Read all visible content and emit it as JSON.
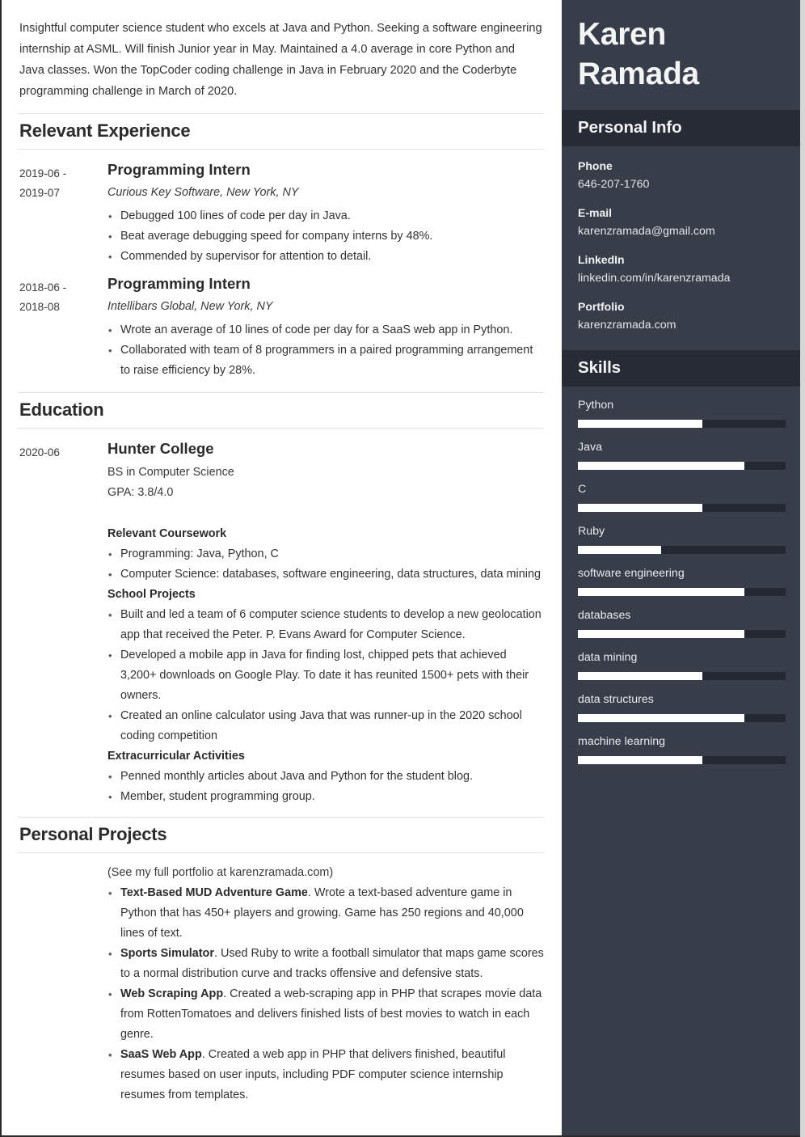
{
  "summary": "Insightful computer science student who excels at Java and Python. Seeking a software engineering internship at ASML. Will finish Junior year in May. Maintained a 4.0 average in core Python and Java classes. Won the TopCoder coding challenge in Java in February 2020 and the Coderbyte programming challenge in March of 2020.",
  "sections": {
    "experience": {
      "title": "Relevant Experience",
      "entries": [
        {
          "date": "2019-06 -\n2019-07",
          "date_line1": "2019-06 -",
          "date_line2": "2019-07",
          "title": "Programming Intern",
          "subtitle": "Curious Key Software, New York, NY",
          "bullets": [
            "Debugged 100 lines of code per day in Java.",
            "Beat average debugging speed for company interns by 48%.",
            "Commended by supervisor for attention to detail."
          ]
        },
        {
          "date_line1": "2018-06 -",
          "date_line2": "2018-08",
          "title": "Programming Intern",
          "subtitle": "Intellibars Global, New York, NY",
          "bullets": [
            "Wrote an average of 10 lines of code per day for a SaaS web app in Python.",
            "Collaborated with team of 8 programmers in a paired programming arrangement to raise efficiency by 28%."
          ]
        }
      ]
    },
    "education": {
      "title": "Education",
      "date": "2020-06",
      "school": "Hunter College",
      "degree": "BS in Computer Science",
      "gpa": "GPA: 3.8/4.0",
      "coursework_head": "Relevant Coursework",
      "coursework": [
        "Programming: Java, Python, C",
        "Computer Science: databases, software engineering, data structures, data mining"
      ],
      "projects_head": "School Projects",
      "projects": [
        "Built and led a team of 6 computer science students to develop a new geolocation app that received the Peter. P. Evans Award for Computer Science.",
        "Developed a mobile app in Java for finding lost, chipped pets that achieved 3,200+ downloads on Google Play. To date it has reunited 1500+ pets with their owners.",
        "Created an online calculator using Java that was runner-up in the 2020 school coding competition"
      ],
      "extracurricular_head": "Extracurricular Activities",
      "extracurricular": [
        "Penned monthly articles about Java and Python for the student blog.",
        "Member, student programming group."
      ]
    },
    "personal_projects": {
      "title": "Personal Projects",
      "note": "(See my full portfolio at karenzramada.com)",
      "items": [
        {
          "name": "Text-Based MUD Adventure Game",
          "desc": ". Wrote a text-based adventure game in Python that has 450+ players and growing. Game has 250 regions and 40,000 lines of text."
        },
        {
          "name": "Sports Simulator",
          "desc": ". Used Ruby to write a football simulator that maps game scores to a normal distribution curve and tracks offensive and defensive stats."
        },
        {
          "name": "Web Scraping App",
          "desc": ". Created a web-scraping app in PHP that scrapes movie data from RottenTomatoes and delivers finished lists of best movies to watch in each genre."
        },
        {
          "name": "SaaS Web App",
          "desc": ". Created a web app in PHP that delivers finished, beautiful resumes based on user inputs, including PDF computer science internship resumes from templates."
        }
      ]
    }
  },
  "sidebar": {
    "name_line1": "Karen",
    "name_line2": "Ramada",
    "personal_info_title": "Personal Info",
    "contact": [
      {
        "label": "Phone",
        "value": "646-207-1760"
      },
      {
        "label": "E-mail",
        "value": "karenzramada@gmail.com"
      },
      {
        "label": "LinkedIn",
        "value": "linkedin.com/in/karenzramada"
      },
      {
        "label": "Portfolio",
        "value": "karenzramada.com"
      }
    ],
    "skills_title": "Skills",
    "skills": [
      {
        "name": "Python",
        "level": 60
      },
      {
        "name": "Java",
        "level": 80
      },
      {
        "name": "C",
        "level": 60
      },
      {
        "name": "Ruby",
        "level": 40
      },
      {
        "name": "software engineering",
        "level": 80
      },
      {
        "name": "databases",
        "level": 80
      },
      {
        "name": "data mining",
        "level": 60
      },
      {
        "name": "data structures",
        "level": 80
      },
      {
        "name": "machine learning",
        "level": 60
      }
    ]
  },
  "colors": {
    "sidebar_bg": "#373d49",
    "sidebar_header_bg": "#262b36",
    "skill_track": "#232833",
    "skill_fill": "#ffffff",
    "page_bg": "#ffffff",
    "rule": "#e2e2e2"
  }
}
